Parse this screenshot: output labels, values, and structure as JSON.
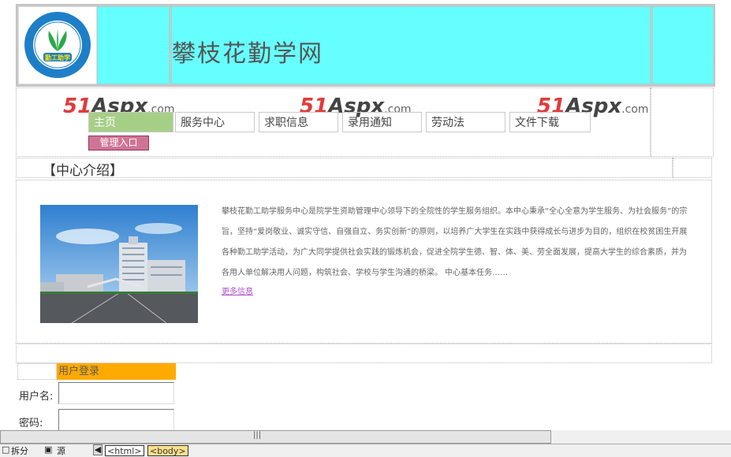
{
  "header": {
    "logo_text": "勤工助学",
    "site_title": "攀枝花勤学网"
  },
  "watermark": {
    "num": "51",
    "word": "Aspx",
    "dot": ".com"
  },
  "nav": {
    "items": [
      {
        "label": "主页"
      },
      {
        "label": "服务中心"
      },
      {
        "label": "求职信息"
      },
      {
        "label": "录用通知"
      },
      {
        "label": "劳动法"
      },
      {
        "label": "文件下载"
      }
    ],
    "admin_label": "管理入口"
  },
  "section": {
    "title": "【中心介绍】"
  },
  "content": {
    "intro": "攀枝花勤工助学服务中心是院学生资助管理中心领导下的全院性的学生服务组织。本中心秉承“全心全意为学生服务、为社会服务”的宗旨，坚持“爱岗敬业、诚实守信、自强自立、务实创新”的原则，以培养广大学生在实践中获得成长与进步为目的，组织在校贫困生开展各种勤工助学活动，为广大同学提供社会实践的锻炼机会，促进全院学生德、智、体、美、劳全面发展，提高大学生的综合素质，并为各用人单位解决用人问题，构筑社会、学校与学生沟通的桥梁。 中心基本任务……",
    "more_link": "更多信息"
  },
  "login": {
    "header": "用户登录",
    "username_label": "用户名:",
    "password_label": "密码:"
  },
  "editor": {
    "split_label": "拆分",
    "source_label": "源",
    "tags": [
      "<html>",
      "<body>"
    ]
  }
}
